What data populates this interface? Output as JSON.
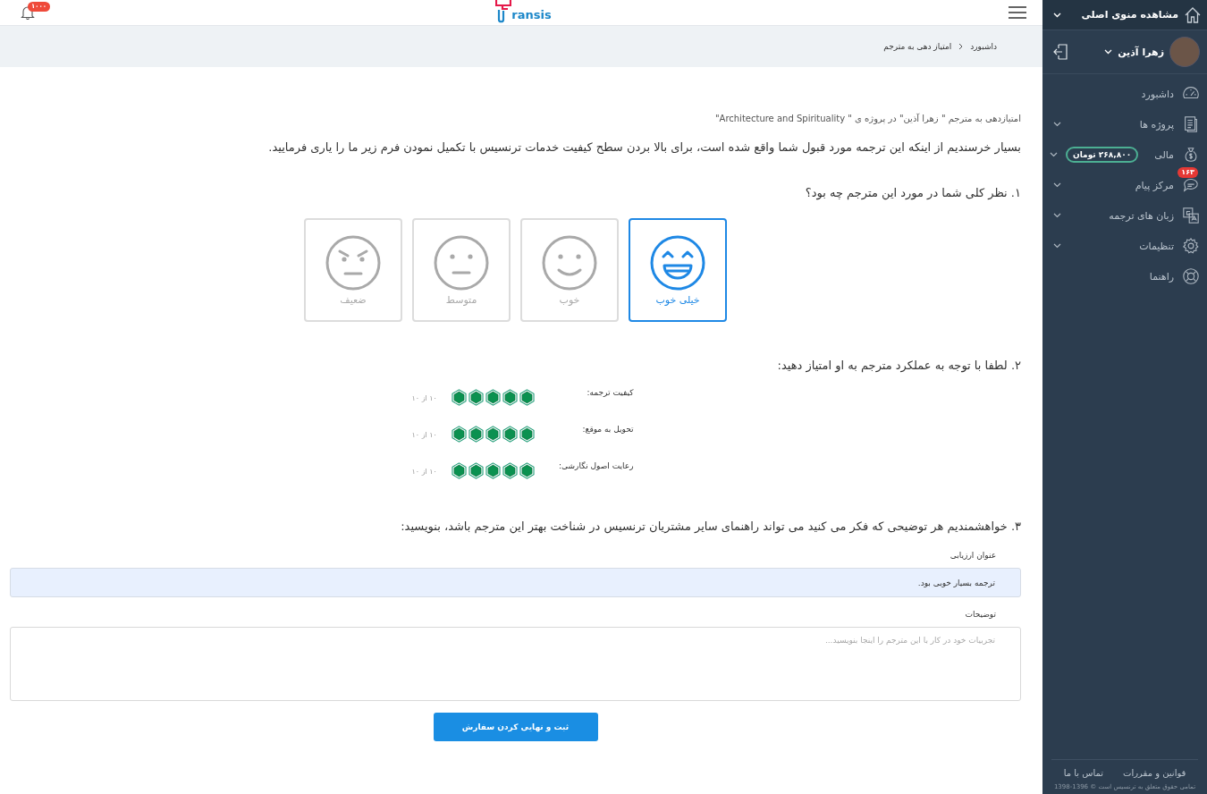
{
  "sidebar": {
    "main_menu": {
      "label": "مشاهده منوی اصلی"
    },
    "user": {
      "name": "زهرا آذین"
    },
    "items": [
      {
        "label": "داشبورد",
        "kind": "link"
      },
      {
        "label": "پروژه ها",
        "kind": "submenu"
      },
      {
        "label": "مالی",
        "kind": "submenu",
        "balance": "۲۶۸,۸۰۰ تومان"
      },
      {
        "label": "مرکز پیام",
        "kind": "submenu",
        "count": "۱۶۳"
      },
      {
        "label": "زبان های ترجمه",
        "kind": "submenu"
      },
      {
        "label": "تنظیمات",
        "kind": "submenu"
      },
      {
        "label": "راهنما",
        "kind": "link"
      }
    ],
    "footer": {
      "links": [
        "قوانین و مقررات",
        "تماس با ما"
      ],
      "copyright": "تمامی حقوق متعلق به ترنسیس است © 1396-1398"
    }
  },
  "topbar": {
    "logo_text": "ransis",
    "notifications": "۱۰۰۰"
  },
  "breadcrumb": [
    "داشبورد",
    "امتیاز دهی به مترجم"
  ],
  "subtitle": "امتیازدهی به مترجم \" زهرا آذین\" در پروژه ی \" Architecture and Spirituality\"",
  "intro": "بسیار خرسندیم از اینکه این ترجمه مورد قبول شما واقع شده است، برای بالا بردن سطح کیفیت خدمات ترنسیس با تکمیل نمودن فرم زیر ما را یاری فرمایید.",
  "question_1": {
    "title": "۱. نظر کلی شما در مورد این مترجم چه بود؟",
    "options": [
      {
        "label": "خیلی خوب",
        "selected": true
      },
      {
        "label": "خوب",
        "selected": false
      },
      {
        "label": "متوسط",
        "selected": false
      },
      {
        "label": "ضعیف",
        "selected": false
      }
    ]
  },
  "question_2": {
    "title": "۲. لطفا با توجه به عملکرد مترجم به او امتیاز دهید:",
    "criteria": [
      {
        "label": "کیفیت ترجمه:",
        "stars": 5,
        "score": "۱۰ از ۱۰"
      },
      {
        "label": "تحویل به موقع:",
        "stars": 5,
        "score": "۱۰ از ۱۰"
      },
      {
        "label": "رعایت اصول نگارشی:",
        "stars": 5,
        "score": "۱۰ از ۱۰"
      }
    ]
  },
  "question_3": {
    "title": "۳. خواهشمندیم هر توضیحی که فکر می کنید می تواند راهنمای سایر مشتریان ترنسیس در شناخت بهتر این مترجم باشد، بنویسید:",
    "title_field": {
      "label": "عنوان ارزیابی",
      "value": "ترجمه بسیار خوبی بود."
    },
    "description_field": {
      "label": "توضیحات",
      "placeholder": "تجربیات خود در کار با این مترجم را اینجا بنویسید..."
    }
  },
  "submit_button": "ثبت و نهایی کردن سفارش"
}
